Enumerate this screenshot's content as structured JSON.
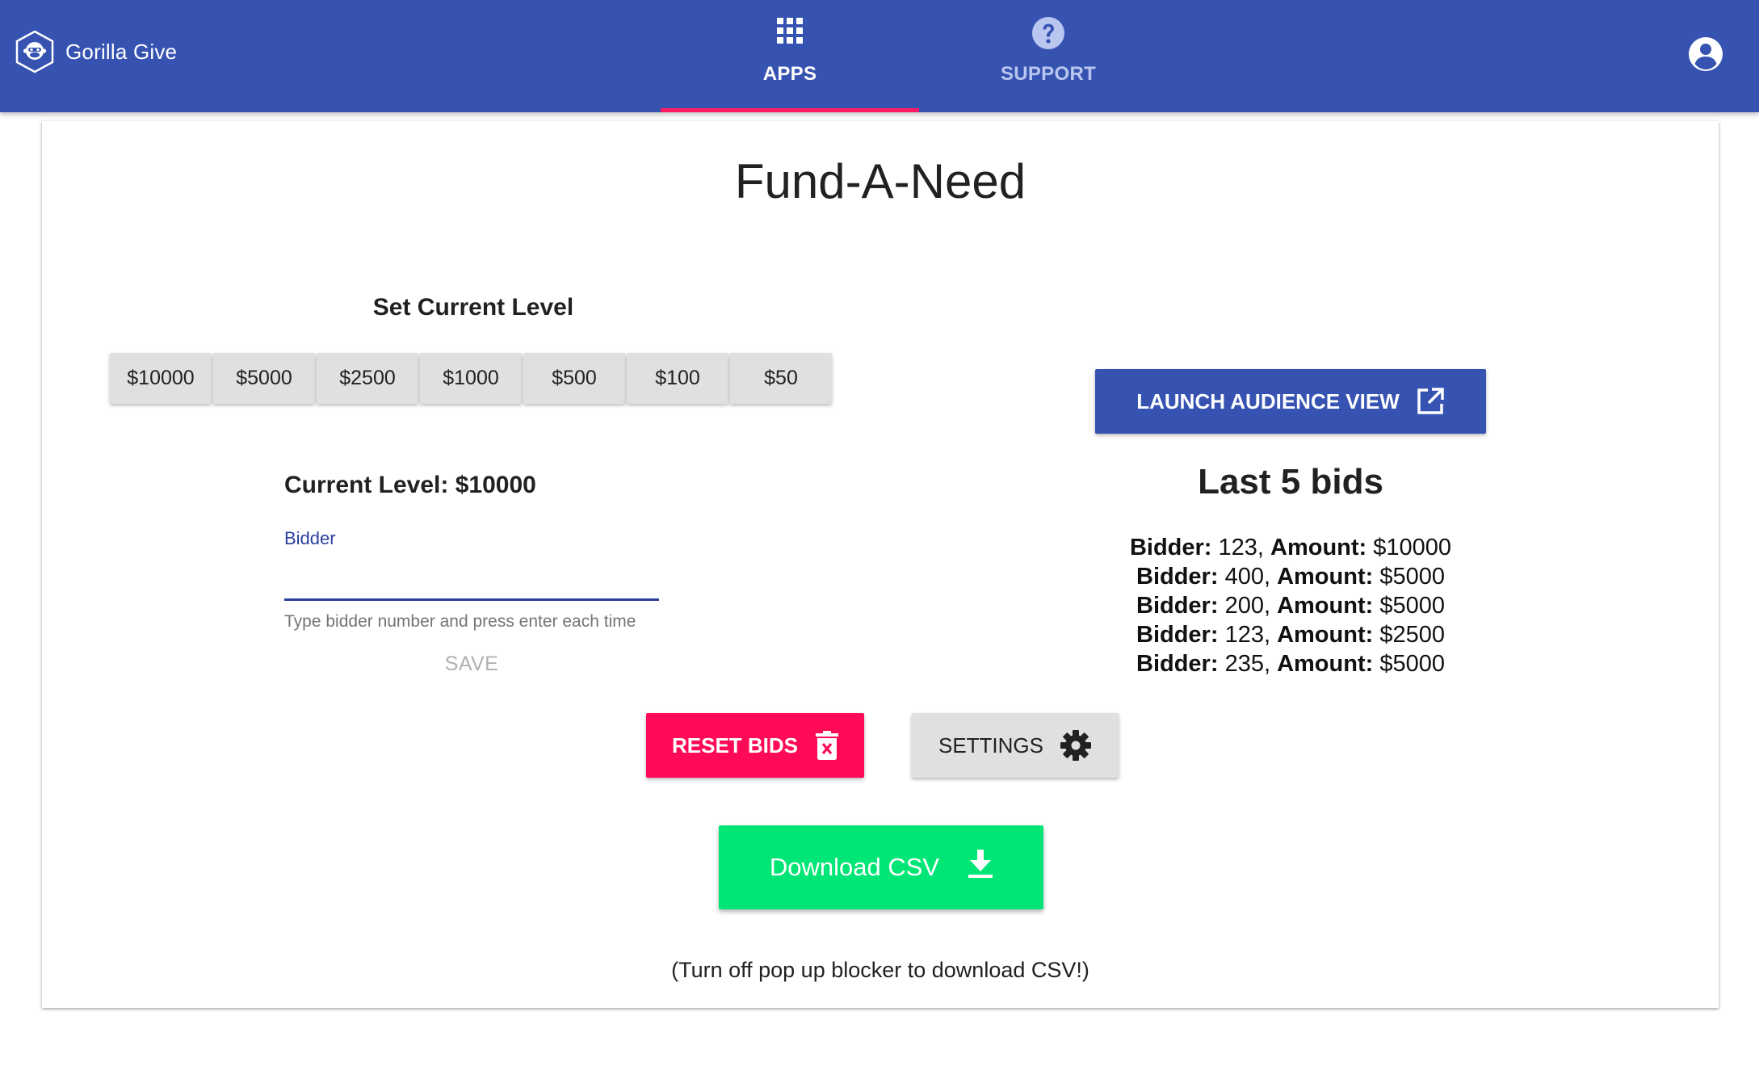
{
  "app": {
    "name": "Gorilla Give",
    "logo_icon": "gorilla-logo-icon"
  },
  "nav": {
    "tabs": [
      {
        "label": "APPS",
        "icon": "apps-grid-icon",
        "active": true
      },
      {
        "label": "SUPPORT",
        "icon": "help-circle-icon",
        "active": false
      }
    ],
    "account_icon": "account-circle-icon"
  },
  "colors": {
    "primary": "#3753b2",
    "accent": "#ff1a66",
    "reset": "#ff0a57",
    "csv": "#00e676",
    "neutral_button": "#e0e0e0"
  },
  "page": {
    "title": "Fund-A-Need"
  },
  "levels": {
    "heading": "Set Current Level",
    "buttons": [
      "$10000",
      "$5000",
      "$2500",
      "$1000",
      "$500",
      "$100",
      "$50"
    ],
    "current_label": "Current Level: $10000"
  },
  "bidder": {
    "label": "Bidder",
    "value": "",
    "hint": "Type bidder number and press enter each time",
    "save_label": "SAVE"
  },
  "audience": {
    "launch_label": "LAUNCH AUDIENCE VIEW",
    "launch_icon": "open-in-new-icon"
  },
  "bids": {
    "title": "Last 5 bids",
    "bidder_key": "Bidder:",
    "amount_key": "Amount:",
    "items": [
      {
        "bidder": "123",
        "amount": "$10000"
      },
      {
        "bidder": "400",
        "amount": "$5000"
      },
      {
        "bidder": "200",
        "amount": "$5000"
      },
      {
        "bidder": "123",
        "amount": "$2500"
      },
      {
        "bidder": "235",
        "amount": "$5000"
      }
    ]
  },
  "actions": {
    "reset_label": "RESET BIDS",
    "reset_icon": "delete-forever-icon",
    "settings_label": "SETTINGS",
    "settings_icon": "gear-icon",
    "csv_label": "Download CSV",
    "csv_icon": "download-icon",
    "csv_note": "(Turn off pop up blocker to download CSV!)"
  }
}
